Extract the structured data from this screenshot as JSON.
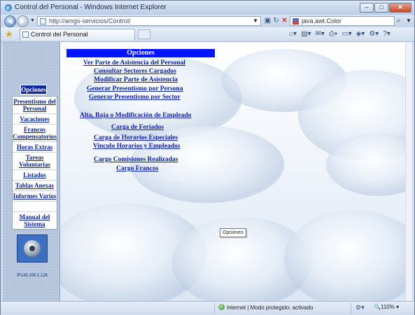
{
  "window": {
    "title": "Control del Personal - Windows Internet Explorer"
  },
  "address": {
    "url": "http://amgs-servicios/Control/"
  },
  "search": {
    "value": "java.awt.Color"
  },
  "tab": {
    "label": "Control del Personal"
  },
  "sidebar": {
    "heading": "Opciones",
    "items": [
      {
        "label": "Presentismo del Personal"
      },
      {
        "label": "Vacaciones"
      },
      {
        "label": "Francos Compensatorios"
      },
      {
        "label": "Horas Extras"
      },
      {
        "label": "Tareas Voluntarias"
      },
      {
        "label": "Listados"
      },
      {
        "label": "Tablas Anexas"
      },
      {
        "label": "Informes Varios"
      },
      {
        "label": ""
      },
      {
        "label": "Manual del Sistema"
      }
    ],
    "ip": "IP143.100.1.126"
  },
  "main": {
    "heading": "Opciones",
    "links": [
      {
        "label": "Ver Parte de Asistencia del Personal"
      },
      {
        "label": "Consultar Sectores Cargados"
      },
      {
        "label": "Modificar Parte de Asistencia"
      },
      {
        "label": "Generar Presentismo por Persona"
      },
      {
        "label": "Generar Presentismo por Sector"
      },
      {
        "label": "Alta, Baja o Modificación de Empleado"
      },
      {
        "label": "Carga de Feriados"
      },
      {
        "label": "Carga de Horarios Especiales"
      },
      {
        "label": "Vinculo Horarios y Empleados"
      },
      {
        "label": "Cargo Comisiones Realizadas"
      },
      {
        "label": "Cargo Francos"
      }
    ],
    "tooltip": "Opciones"
  },
  "status": {
    "zone": "Internet | Modo protegido: activado",
    "zoom": "110%"
  }
}
